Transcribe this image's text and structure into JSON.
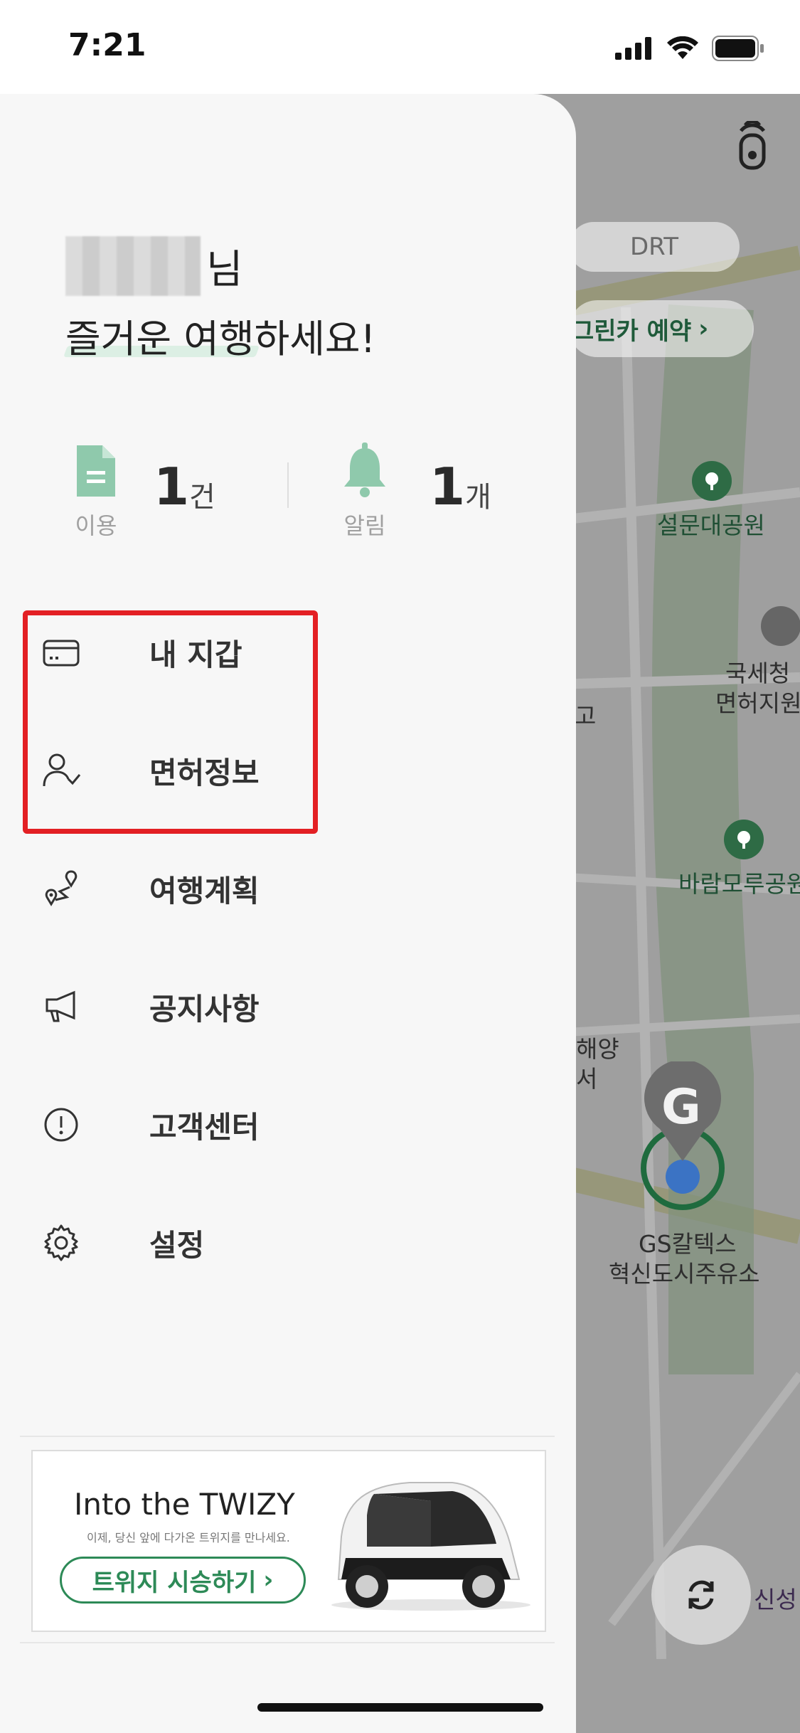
{
  "status_bar": {
    "time": "7:21"
  },
  "map": {
    "chips": {
      "drt": "DRT",
      "reserve": "그린카 예약"
    },
    "labels": {
      "park1": "설문대공원",
      "office_l1": "국세청",
      "office_l2": "면허지원",
      "go": "고",
      "park2": "바람모루공원",
      "sea_l1": "해양",
      "sea_l2": "서",
      "gs_l1": "GS칼텍스",
      "gs_l2": "혁신도시주유소",
      "sinsung": "신성"
    },
    "marker_letter": "G"
  },
  "drawer": {
    "greeting_suffix": "님",
    "greeting": "즐거운 여행하세요!",
    "stats": [
      {
        "label": "이용",
        "value": "1",
        "unit": "건",
        "icon": "document-icon"
      },
      {
        "label": "알림",
        "value": "1",
        "unit": "개",
        "icon": "bell-icon"
      }
    ],
    "menu": [
      {
        "label": "내 지갑",
        "icon": "wallet-card-icon"
      },
      {
        "label": "면허정보",
        "icon": "user-check-icon"
      },
      {
        "label": "여행계획",
        "icon": "route-pin-icon"
      },
      {
        "label": "공지사항",
        "icon": "megaphone-icon"
      },
      {
        "label": "고객센터",
        "icon": "alert-circle-icon"
      },
      {
        "label": "설정",
        "icon": "gear-icon"
      }
    ],
    "banner": {
      "title": "Into the TWIZY",
      "subtitle": "이제, 당신 앞에 다가온 트위지를 만나세요.",
      "button": "트위지 시승하기"
    }
  },
  "colors": {
    "accent": "#2d8a57",
    "highlight": "#e32024"
  }
}
